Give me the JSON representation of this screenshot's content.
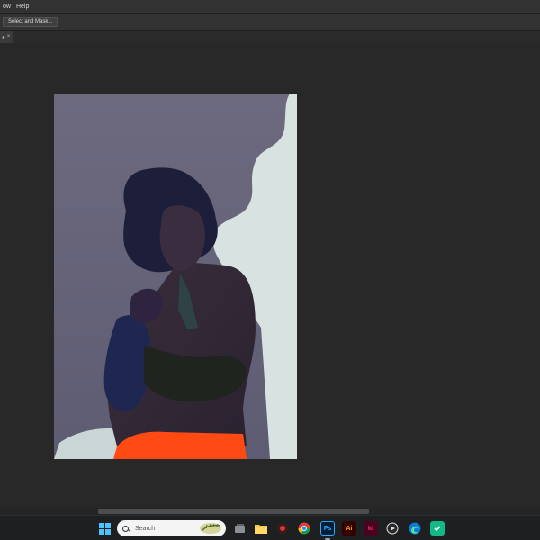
{
  "menubar": {
    "items": [
      "ow",
      "Help"
    ]
  },
  "options_bar": {
    "select_and_mask_label": "Select and Mask..."
  },
  "document_tab": {
    "arrow": "▸",
    "close": "×"
  },
  "taskbar": {
    "search_placeholder": "Search",
    "apps": [
      {
        "name": "windows-start-icon"
      },
      {
        "name": "file-explorer-icon"
      },
      {
        "name": "chrome-icon"
      },
      {
        "name": "photoshop-icon",
        "label": "Ps"
      },
      {
        "name": "illustrator-icon",
        "label": "Ai"
      },
      {
        "name": "indesign-icon",
        "label": "Id"
      },
      {
        "name": "media-player-icon"
      },
      {
        "name": "edge-icon"
      },
      {
        "name": "security-shield-icon"
      }
    ]
  },
  "colors": {
    "ui_dark": "#282828",
    "panel": "#323232",
    "photoshop": "#31a8ff",
    "illustrator": "#ff9a00",
    "indesign": "#ff3366"
  }
}
